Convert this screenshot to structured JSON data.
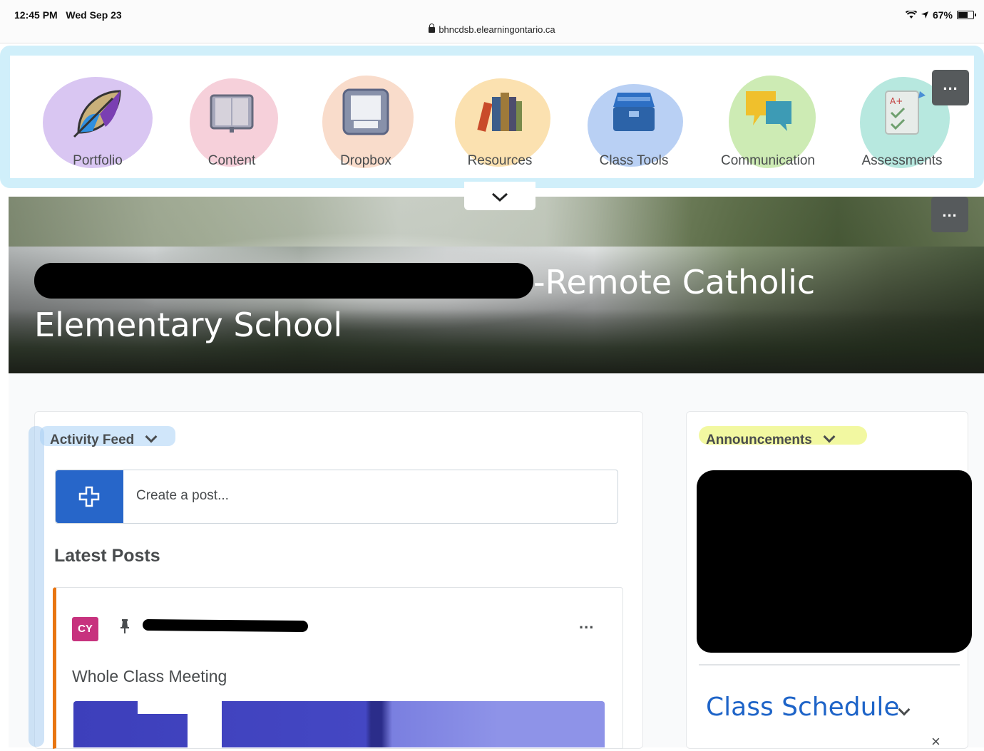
{
  "status_bar": {
    "time": "12:45 PM",
    "date": "Wed Sep 23",
    "url": "bhncdsb.elearningontario.ca",
    "battery": "67%"
  },
  "nav": {
    "items": [
      {
        "label": "Portfolio",
        "icon": "portfolio-leaf-icon",
        "highlight": "#d9c6f2"
      },
      {
        "label": "Content",
        "icon": "book-icon",
        "highlight": "#f6d0da"
      },
      {
        "label": "Dropbox",
        "icon": "dropbox-tray-icon",
        "highlight": "#f9dccb"
      },
      {
        "label": "Resources",
        "icon": "books-icon",
        "highlight": "#fbe1b0"
      },
      {
        "label": "Class Tools",
        "icon": "toolbox-icon",
        "highlight": "#b9d0f4"
      },
      {
        "label": "Communication",
        "icon": "speech-bubbles-icon",
        "highlight": "#cdebb4"
      },
      {
        "label": "Assessments",
        "icon": "assessment-checklist-icon",
        "highlight": "#b7e8df"
      }
    ],
    "more_label": "..."
  },
  "banner": {
    "title_visible": "-Remote Catholic Elementary School",
    "more_label": "..."
  },
  "activity_feed": {
    "title": "Activity Feed",
    "create_post_placeholder": "Create a post...",
    "latest_posts_label": "Latest Posts",
    "post": {
      "avatar_initials": "CY",
      "title": "Whole Class Meeting",
      "more_label": "..."
    }
  },
  "announcements": {
    "title": "Announcements"
  },
  "class_schedule": {
    "title": "Class Schedule",
    "close_label": "×"
  },
  "colors": {
    "accent_blue": "#2766c9",
    "link_blue": "#1e64c8",
    "post_border_orange": "#e87511",
    "avatar_pink": "#c7327e"
  }
}
